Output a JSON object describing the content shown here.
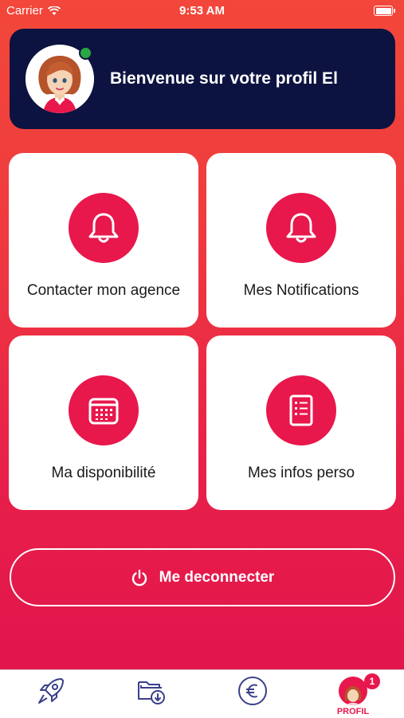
{
  "status_bar": {
    "carrier": "Carrier",
    "time": "9:53 AM"
  },
  "header": {
    "welcome_text": "Bienvenue sur votre profil El",
    "online_color": "#28a745"
  },
  "tiles": [
    {
      "label": "Contacter mon agence",
      "icon": "bell-icon"
    },
    {
      "label": "Mes Notifications",
      "icon": "bell-icon"
    },
    {
      "label": "Ma disponibilité",
      "icon": "calendar-icon"
    },
    {
      "label": "Mes infos perso",
      "icon": "document-icon"
    }
  ],
  "logout": {
    "label": "Me deconnecter",
    "icon": "power-icon"
  },
  "tabbar": {
    "items": [
      {
        "icon": "rocket-icon"
      },
      {
        "icon": "folder-download-icon"
      },
      {
        "icon": "euro-icon"
      },
      {
        "icon": "profile-avatar-icon",
        "label": "PROFIL",
        "badge": "1",
        "active": true
      }
    ]
  },
  "colors": {
    "accent": "#e8174c",
    "header_bg": "#0d1340",
    "gradient_top": "#f2473a",
    "gradient_bottom": "#e2154c",
    "tab_icon": "#3a3f8a"
  }
}
